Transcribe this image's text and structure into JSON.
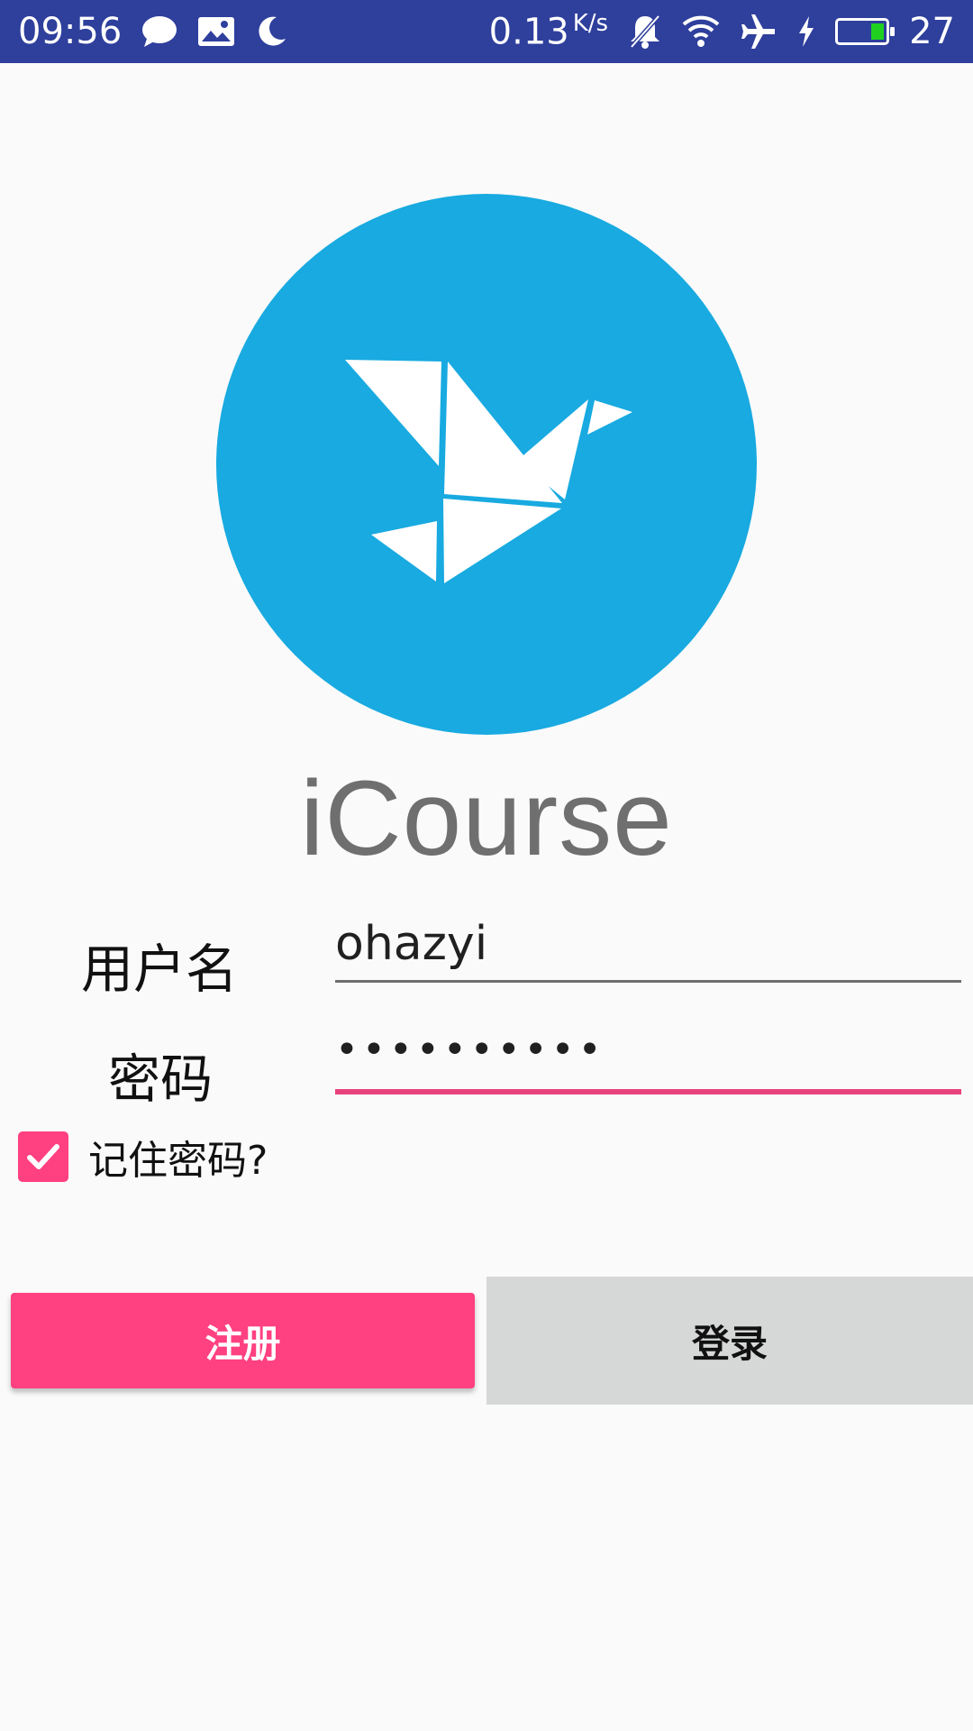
{
  "status_bar": {
    "time": "09:56",
    "net_speed": "0.13",
    "net_speed_unit": "K/s",
    "battery_level": "27",
    "icons": [
      "chat-icon",
      "image-icon",
      "moon-icon",
      "mute-icon",
      "wifi-icon",
      "airplane-icon",
      "charging-icon",
      "battery-icon"
    ],
    "background": "#2e3f9c"
  },
  "logo": {
    "icon": "origami-bird-icon",
    "color": "#18aae0"
  },
  "app": {
    "title": "iCourse"
  },
  "form": {
    "username_label": "用户名",
    "username_value": "ohazyi",
    "password_label": "密码",
    "password_value": "••••••••••",
    "remember_label": "记住密码?",
    "remember_checked": true,
    "accent_color": "#ff4081"
  },
  "buttons": {
    "register_label": "注册",
    "login_label": "登录"
  }
}
